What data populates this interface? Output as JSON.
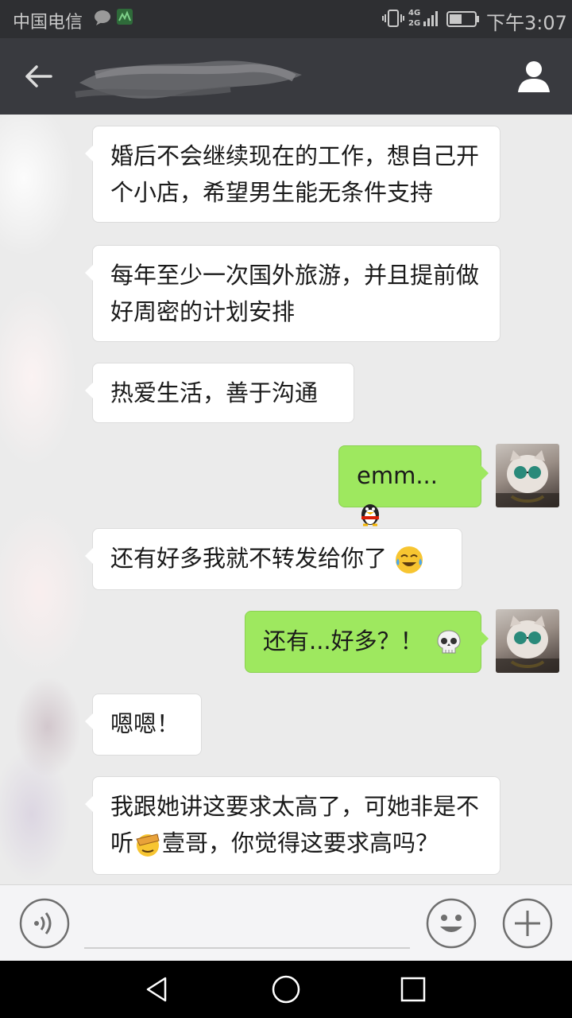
{
  "status_bar": {
    "carrier": "中国电信",
    "network": "4G",
    "network_sub": "2G",
    "time": "下午3:07",
    "battery_level": 0.5
  },
  "header": {
    "contact_name": "",
    "back_icon": "back-arrow-icon",
    "profile_icon": "person-icon"
  },
  "messages": [
    {
      "side": "left",
      "text": "婚后不会继续现在的工作，想自己开个小店，希望男生能无条件支持"
    },
    {
      "side": "left",
      "text": "每年至少一次国外旅游，并且提前做好周密的计划安排"
    },
    {
      "side": "left",
      "text": "热爱生活，善于沟通"
    },
    {
      "side": "right",
      "text": "emm...",
      "emoji": "qq-penguin-emoji"
    },
    {
      "side": "left",
      "text": "还有好多我就不转发给你了",
      "emoji": "crying-laughing-emoji"
    },
    {
      "side": "right",
      "text": "还有...好多？！",
      "emoji": "skull-emoji"
    },
    {
      "side": "left",
      "text": "嗯嗯！"
    },
    {
      "side": "left",
      "text_a": "我跟她讲这要求太高了，可她非是不听",
      "emoji": "facepalm-emoji",
      "text_b": "壹哥，你觉得这要求高吗？"
    }
  ],
  "input_bar": {
    "voice_icon": "voice-icon",
    "emoji_icon": "smiley-icon",
    "more_icon": "plus-icon"
  },
  "nav_bar": {
    "back": "nav-back-icon",
    "home": "nav-home-icon",
    "recent": "nav-recent-icon"
  }
}
